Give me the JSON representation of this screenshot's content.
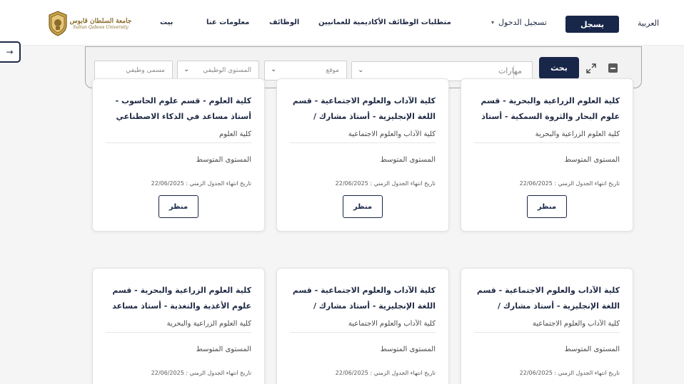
{
  "header": {
    "language": "العربية",
    "register_label": "يسجل",
    "login_label": "تسجيل الدخول",
    "nav": {
      "requirements": "متطلبات الوظائف الأكاديمية للعمانيين",
      "jobs": "الوظائف",
      "about": "معلومات عنا",
      "home": "بيت"
    },
    "logo": {
      "arabic": "جامعة السلطان قابوس",
      "english": "Sultan Qaboos University"
    }
  },
  "filters": {
    "search_label": "بحث",
    "skills_placeholder": "مهارات",
    "location_placeholder": "موقع",
    "level_placeholder": "المستوى الوظيفي",
    "job_title_placeholder": "مسمى وظيفي"
  },
  "cards": [
    {
      "title": "كلية العلوم الزراعية والبحرية - قسم علوم البحار والثروة السمكية - أستاذ مساعد...",
      "college": "كلية العلوم الزراعية والبحرية",
      "level": "المستوى المتوسط",
      "date": "تاريخ انتهاء الجدول الزمني : 22/06/2025",
      "button": "منظر"
    },
    {
      "title": "كلية الآداب والعلوم الاجتماعية - قسم اللغة الإنجليزية - أستاذ مشارك / مساعد...",
      "college": "كلية الآداب والعلوم الاجتماعية",
      "level": "المستوى المتوسط",
      "date": "تاريخ انتهاء الجدول الزمني : 22/06/2025",
      "button": "منظر"
    },
    {
      "title": "كلية العلوم - قسم علوم الحاسوب - أستاذ مساعد في الذكاء الاصطناعي والتعلم...",
      "college": "كلية العلوم",
      "level": "المستوى المتوسط",
      "date": "تاريخ انتهاء الجدول الزمني : 22/06/2025",
      "button": "منظر"
    },
    {
      "title": "كلية الآداب والعلوم الاجتماعية - قسم اللغة الإنجليزية - أستاذ مشارك / مساعد...",
      "college": "كلية الآداب والعلوم الاجتماعية",
      "level": "المستوى المتوسط",
      "date": "تاريخ انتهاء الجدول الزمني : 22/06/2025",
      "button": "منظر"
    },
    {
      "title": "كلية الآداب والعلوم الاجتماعية - قسم اللغة الإنجليزية - أستاذ مشارك / مساعد...",
      "college": "كلية الآداب والعلوم الاجتماعية",
      "level": "المستوى المتوسط",
      "date": "تاريخ انتهاء الجدول الزمني : 22/06/2025",
      "button": "منظر"
    },
    {
      "title": "كلية العلوم الزراعية والبحرية - قسم علوم الأغذية والتغذية - أستاذ مساعد في...",
      "college": "كلية العلوم الزراعية والبحرية",
      "level": "المستوى المتوسط",
      "date": "تاريخ انتهاء الجدول الزمني : 22/06/2025",
      "button": "منظر"
    }
  ],
  "colors": {
    "primary": "#182649",
    "logo_gold": "#8a6d2d",
    "background": "#f5f5f5"
  },
  "icons": {
    "side": "arrow-right-icon",
    "expand": "expand-icon",
    "collapse": "minus-square-icon",
    "dropdown": "chevron-down-icon"
  }
}
